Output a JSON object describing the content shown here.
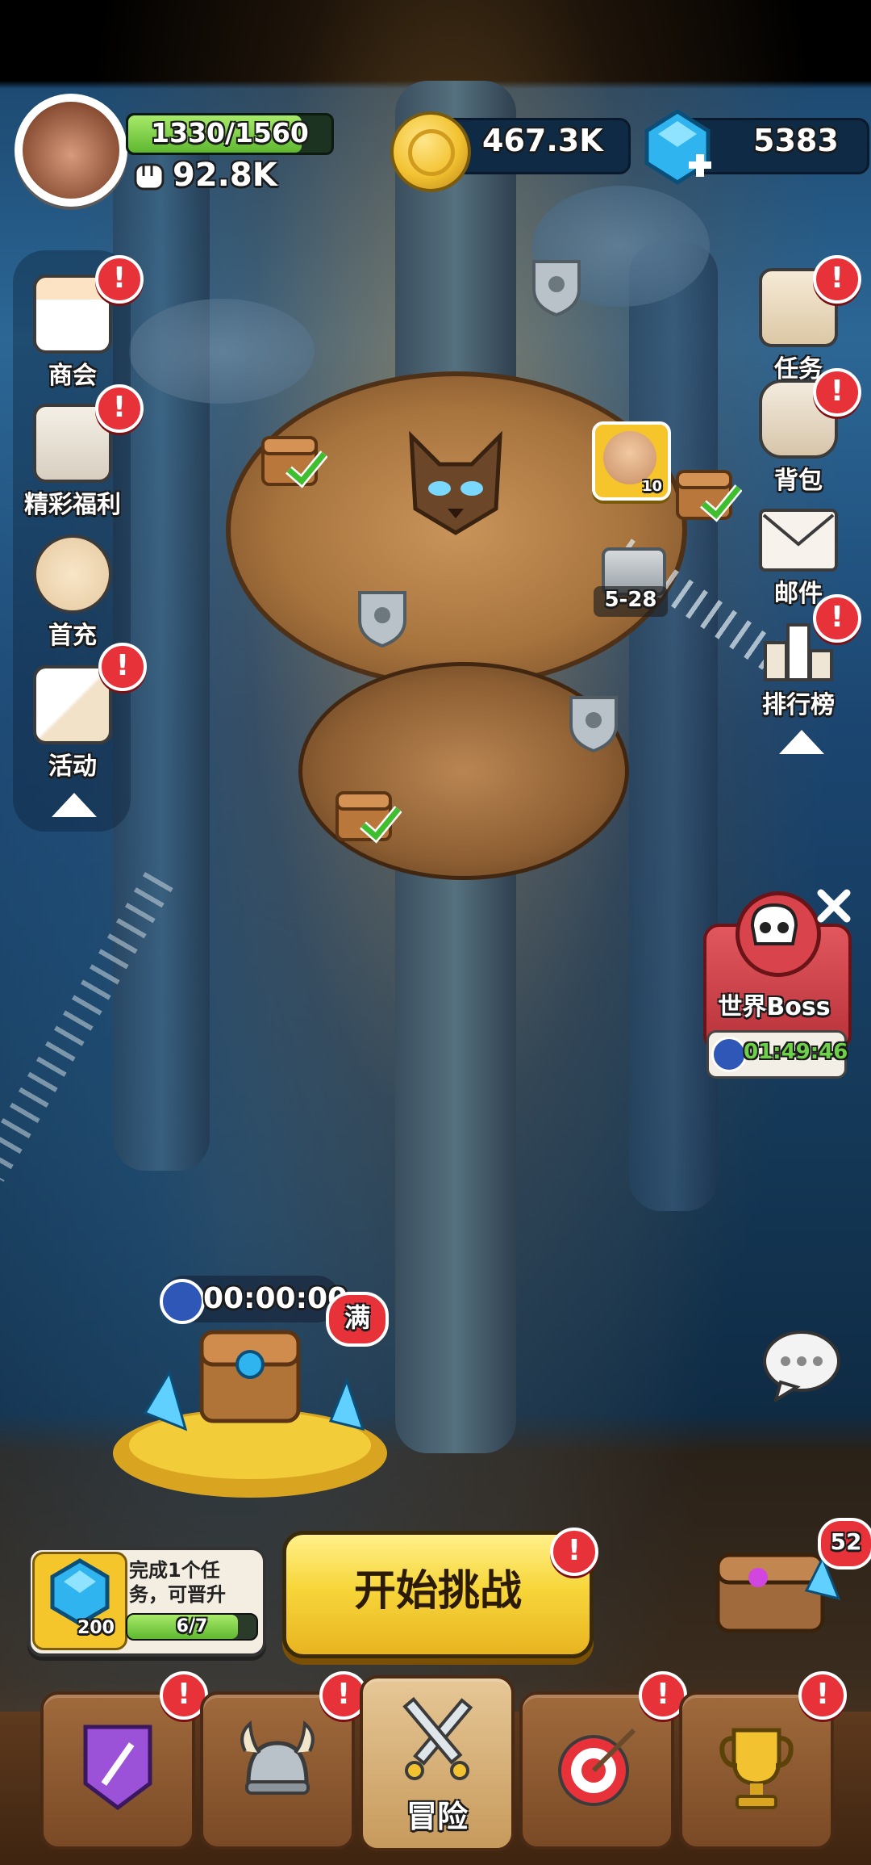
{
  "player": {
    "hp_text": "1330/1560",
    "hp_current": 1330,
    "hp_max": 1560,
    "power": "92.8K",
    "avatar_icon": "caveman-avatar-icon"
  },
  "currency": {
    "gold": "467.3K",
    "gems": "5383",
    "gold_icon": "gold-coin-icon",
    "gem_icon": "blue-gem-icon"
  },
  "left_menu": [
    {
      "label": "商会",
      "icon": "shop-icon",
      "alert": true
    },
    {
      "label": "精彩福利",
      "icon": "gift-box-icon",
      "alert": true
    },
    {
      "label": "首充",
      "icon": "first-recharge-icon",
      "alert": false
    },
    {
      "label": "活动",
      "icon": "event-cards-icon",
      "alert": true
    }
  ],
  "right_menu": [
    {
      "label": "任务",
      "icon": "quest-scroll-icon",
      "alert": true
    },
    {
      "label": "背包",
      "icon": "backpack-icon",
      "alert": true
    },
    {
      "label": "邮件",
      "icon": "mail-icon",
      "alert": false
    },
    {
      "label": "排行榜",
      "icon": "podium-icon",
      "alert": true
    }
  ],
  "map": {
    "stage_label": "5-28",
    "current_level_suffix": "10"
  },
  "world_boss": {
    "title": "世界Boss",
    "timer": "01:49:46"
  },
  "idle_chest": {
    "timer": "00:00:00",
    "full_badge": "满"
  },
  "quest_promo": {
    "text": "完成1个任务，可晋升",
    "gem_reward": "200",
    "progress_text": "6/7",
    "progress": 0.857
  },
  "start_button": {
    "label": "开始挑战"
  },
  "treasure_badge": "52",
  "bottom_tabs": [
    {
      "label": "",
      "icon": "sword-banner-icon",
      "alert": true
    },
    {
      "label": "",
      "icon": "viking-helmet-icon",
      "alert": true
    },
    {
      "label": "冒险",
      "icon": "crossed-swords-icon",
      "alert": false,
      "active": true
    },
    {
      "label": "",
      "icon": "target-dart-icon",
      "alert": true
    },
    {
      "label": "",
      "icon": "trophy-icon",
      "alert": true
    }
  ],
  "colors": {
    "hp_green": "#7ed348",
    "alert_red": "#e8323a",
    "gold": "#f2c230",
    "gem_blue": "#2fb4f0",
    "start_yellow": "#f7d63a",
    "boss_red": "#d9444c"
  }
}
